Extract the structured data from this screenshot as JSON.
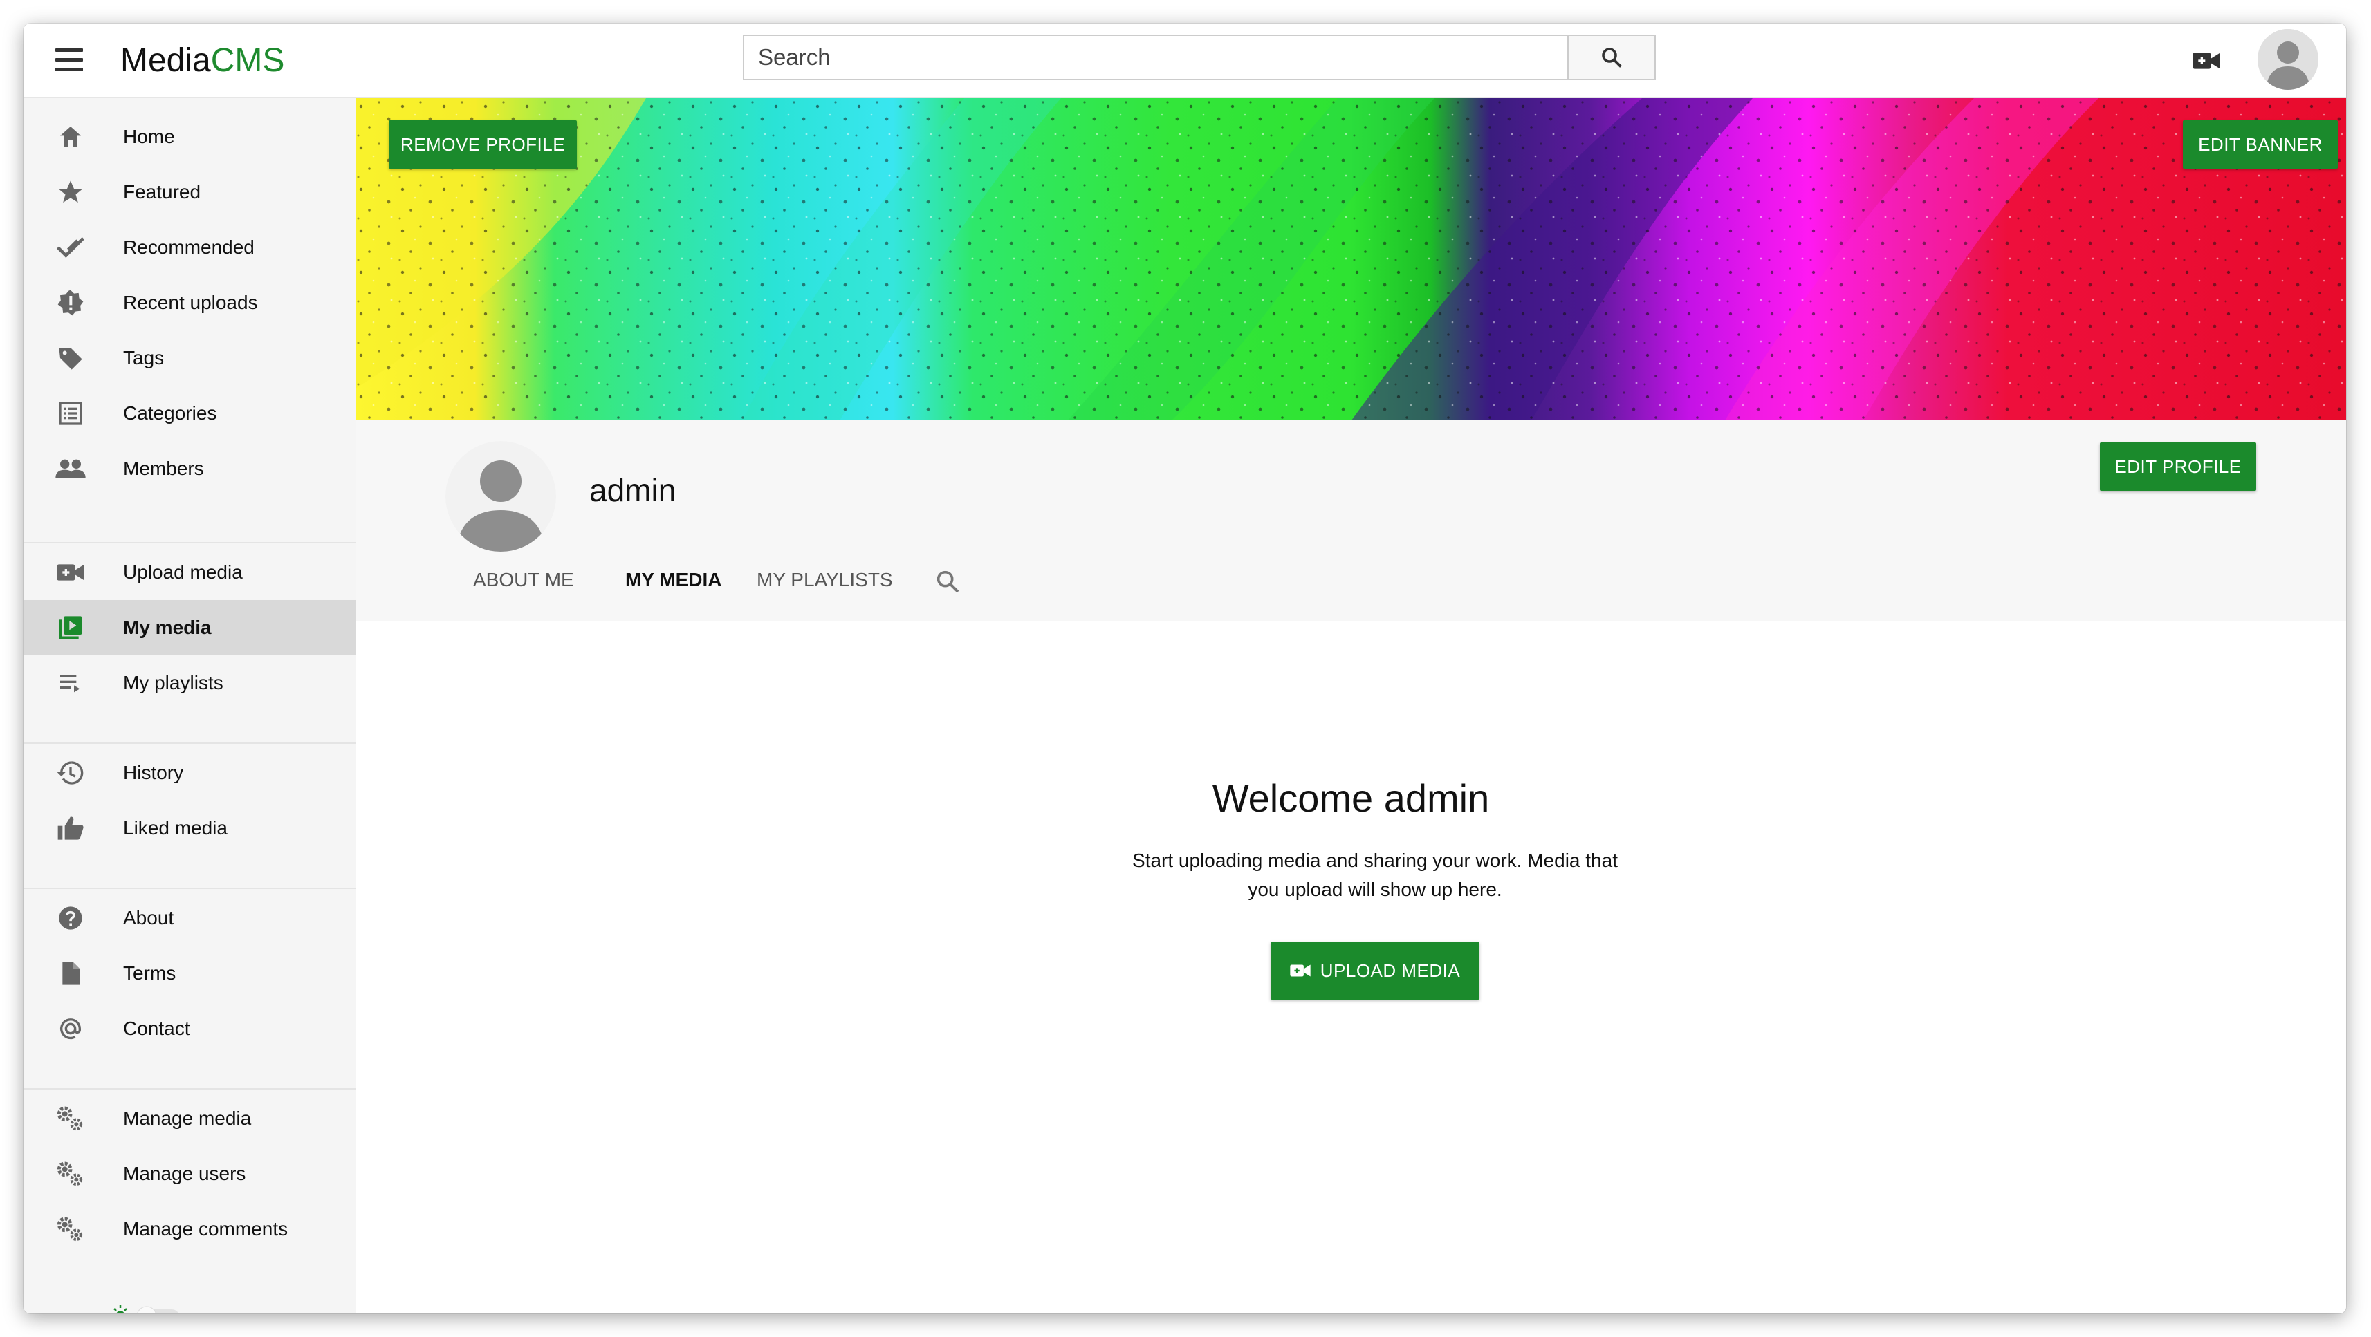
{
  "header": {
    "logo_part1": "Media",
    "logo_part2": "CMS",
    "search_placeholder": "Search"
  },
  "sidebar": {
    "items": [
      {
        "label": "Home",
        "icon": "home-icon"
      },
      {
        "label": "Featured",
        "icon": "star-icon"
      },
      {
        "label": "Recommended",
        "icon": "check-icon"
      },
      {
        "label": "Recent uploads",
        "icon": "new-releases-icon"
      },
      {
        "label": "Tags",
        "icon": "tag-icon"
      },
      {
        "label": "Categories",
        "icon": "list-icon"
      },
      {
        "label": "Members",
        "icon": "people-icon"
      },
      {
        "label": "Upload media",
        "icon": "video-add-icon"
      },
      {
        "label": "My media",
        "icon": "video-library-icon",
        "active": true
      },
      {
        "label": "My playlists",
        "icon": "playlist-icon"
      },
      {
        "label": "History",
        "icon": "history-icon"
      },
      {
        "label": "Liked media",
        "icon": "thumb-up-icon"
      },
      {
        "label": "About",
        "icon": "help-icon"
      },
      {
        "label": "Terms",
        "icon": "document-icon"
      },
      {
        "label": "Contact",
        "icon": "at-icon"
      },
      {
        "label": "Manage media",
        "icon": "gears-icon"
      },
      {
        "label": "Manage users",
        "icon": "gears-icon"
      },
      {
        "label": "Manage comments",
        "icon": "gears-icon"
      }
    ]
  },
  "banner": {
    "remove_profile_label": "REMOVE PROFILE",
    "edit_banner_label": "EDIT BANNER"
  },
  "profile": {
    "name": "admin",
    "edit_profile_label": "EDIT PROFILE",
    "tabs": [
      "ABOUT ME",
      "MY MEDIA",
      "MY PLAYLISTS"
    ],
    "active_tab": "MY MEDIA"
  },
  "welcome": {
    "title": "Welcome admin",
    "text": "Start uploading media and sharing your work. Media that you upload will show up here.",
    "upload_label": "UPLOAD MEDIA"
  },
  "colors": {
    "accent": "#1b8a2c",
    "sidebar_bg": "#f5f5f5",
    "active_item_bg": "#d9d9d9"
  }
}
